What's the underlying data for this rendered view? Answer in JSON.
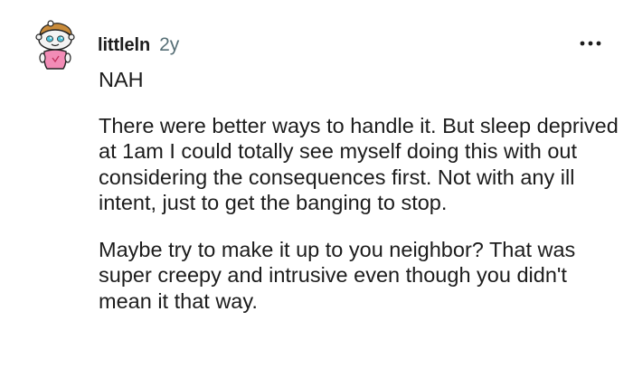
{
  "comment": {
    "username": "littleln",
    "age": "2y",
    "avatar_icon": "snoo-avatar-icon",
    "more_icon": "more-options-icon",
    "paragraphs": [
      "NAH",
      "There were better ways to handle it. But sleep deprived at 1am I could totally see myself doing this with out considering the consequences first. Not with any ill intent, just to get the banging to stop.",
      "Maybe try to make it up to you neighbor? That was super creepy and intrusive even though you didn't mean it that way."
    ]
  },
  "colors": {
    "text": "#1c1c1c",
    "meta": "#576f76",
    "avatar_skin": "#f3f3f3",
    "avatar_hair": "#c98b3a",
    "avatar_shirt": "#f28cb6",
    "avatar_eyes": "#4fc3d9"
  }
}
